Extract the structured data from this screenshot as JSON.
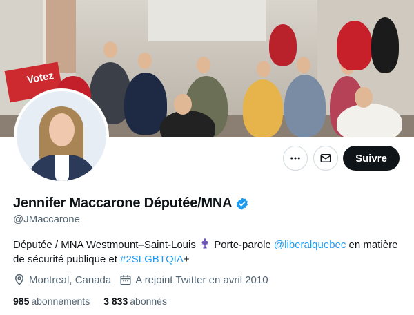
{
  "profile": {
    "display_name": "Jennifer Maccarone Députée/MNA",
    "handle": "@JMaccarone",
    "bio": {
      "part1": "Députée / MNA Westmount–Saint-Louis ",
      "part2": " Porte-parole ",
      "mention": "@liberalquebec",
      "part3": " en matière de sécurité publique et ",
      "hashtag": "#2SLGBTQIA",
      "part4": "+"
    },
    "location": "Montreal, Canada",
    "joined": "A rejoint Twitter en avril 2010",
    "following_count": "985",
    "following_label": "abonnements",
    "followers_count": "3 833",
    "followers_label": "abonnés"
  },
  "banner": {
    "sign_text": "Votez"
  },
  "actions": {
    "follow_label": "Suivre",
    "more_icon": "more-dots-icon",
    "message_icon": "envelope-icon"
  },
  "colors": {
    "link": "#1d9bf0",
    "verified": "#1d9bf0",
    "follow_bg": "#0f1419",
    "secondary_text": "#536471"
  }
}
